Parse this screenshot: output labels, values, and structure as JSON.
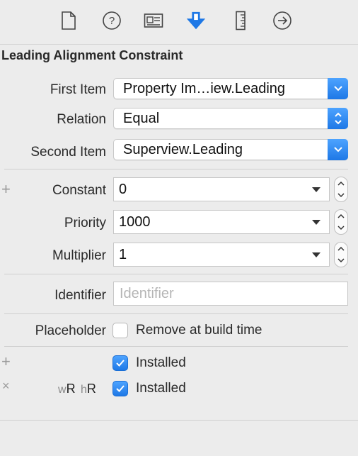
{
  "toolbar": {
    "tabs": [
      {
        "name": "file-inspector"
      },
      {
        "name": "quick-help"
      },
      {
        "name": "identity-inspector"
      },
      {
        "name": "attributes-inspector"
      },
      {
        "name": "size-inspector"
      },
      {
        "name": "connections-inspector"
      }
    ],
    "accent": "#1e78e6"
  },
  "section": {
    "title": "Leading Alignment Constraint"
  },
  "fields": {
    "first_item": {
      "label": "First Item",
      "value": "Property Im…iew.Leading"
    },
    "relation": {
      "label": "Relation",
      "value": "Equal"
    },
    "second_item": {
      "label": "Second Item",
      "value": "Superview.Leading"
    },
    "constant": {
      "label": "Constant",
      "value": "0"
    },
    "priority": {
      "label": "Priority",
      "value": "1000"
    },
    "multiplier": {
      "label": "Multiplier",
      "value": "1"
    },
    "identifier": {
      "label": "Identifier",
      "placeholder": "Identifier"
    },
    "placeholder": {
      "label": "Placeholder",
      "checkbox_label": "Remove at build time",
      "checked": false
    },
    "installed_1": {
      "label": "Installed",
      "checked": true
    },
    "installed_2": {
      "size_class_w": "w",
      "size_class_w_val": "R",
      "size_class_h": "h",
      "size_class_h_val": "R",
      "label": "Installed",
      "checked": true
    }
  }
}
